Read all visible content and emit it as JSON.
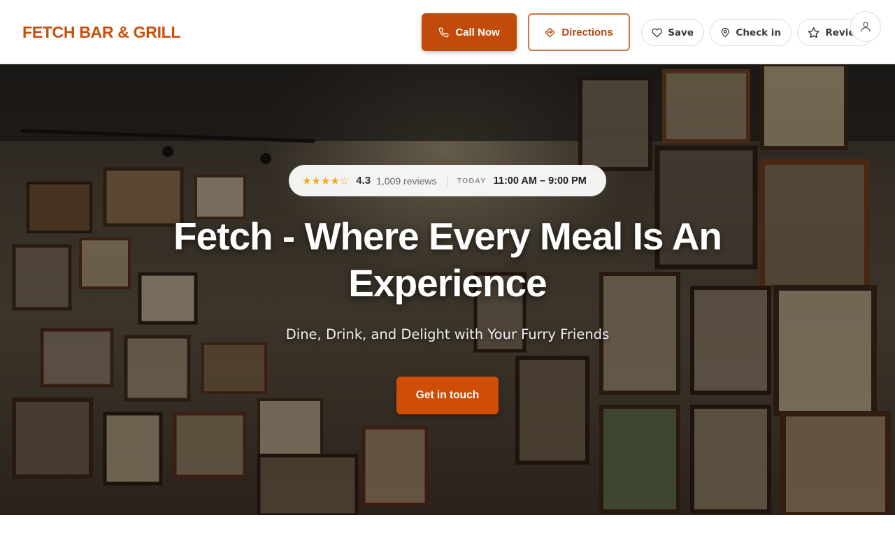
{
  "header": {
    "brand": "FETCH BAR & GRILL",
    "call_label": "Call Now",
    "directions_label": "Directions",
    "save_label": "Save",
    "checkin_label": "Check in",
    "review_label": "Review"
  },
  "hero": {
    "rating": "4.3",
    "rating_stars": 4.3,
    "stars": [
      "★",
      "★",
      "★",
      "★",
      "☆"
    ],
    "review_count": "1,009 reviews",
    "today_label": "TODAY",
    "hours": "11:00 AM – 9:00 PM",
    "title": "Fetch - Where Every Meal Is An Experience",
    "subtitle": "Dine, Drink, and Delight with Your Furry Friends",
    "cta_label": "Get in touch"
  },
  "icons": {
    "call": "phone-icon",
    "directions": "directions-icon",
    "save": "heart-icon",
    "checkin": "map-pin-icon",
    "review": "star-icon",
    "account": "user-icon"
  },
  "colors": {
    "brand": "#c9500a",
    "primary_button": "#c24a0a",
    "cta": "#cf4d06",
    "star": "#f2a81d"
  }
}
